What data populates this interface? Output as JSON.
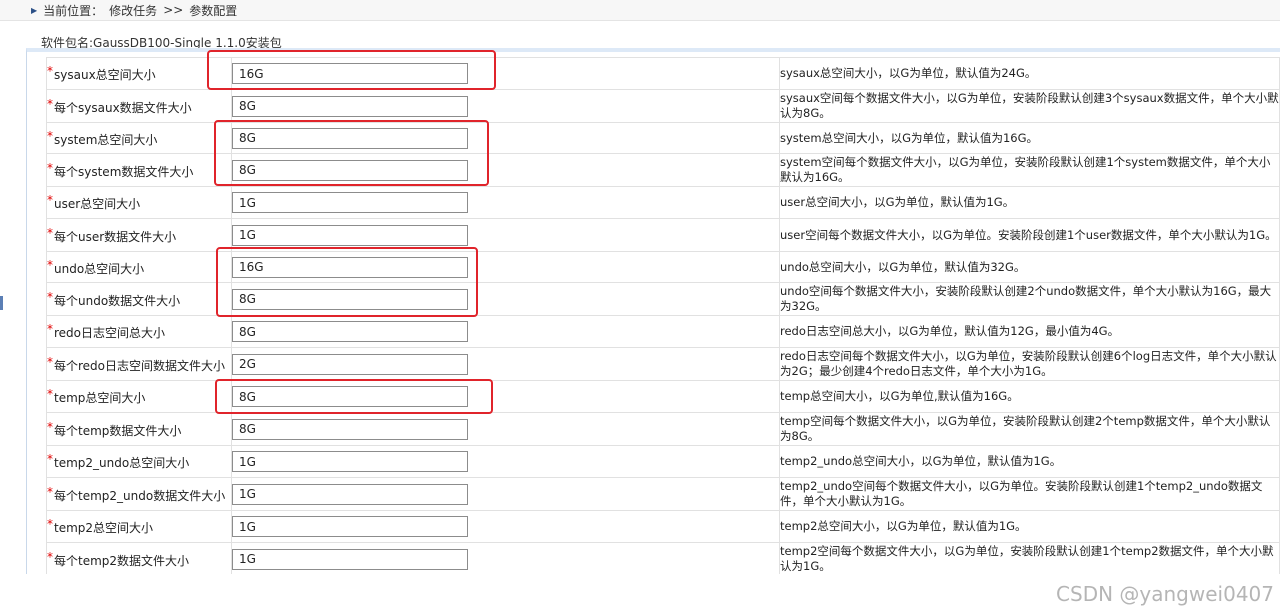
{
  "breadcrumb": {
    "prefix": "当前位置：",
    "item1": "修改任务",
    "sep": ">>",
    "item2": "参数配置"
  },
  "package_label": "软件包名:GaussDB100-Single 1.1.0安装包",
  "rows": [
    {
      "label": "sysaux总空间大小",
      "value": "16G",
      "desc": "sysaux总空间大小，以G为单位，默认值为24G。"
    },
    {
      "label": "每个sysaux数据文件大小",
      "value": "8G",
      "desc": "sysaux空间每个数据文件大小，以G为单位，安装阶段默认创建3个sysaux数据文件，单个大小默认为8G。"
    },
    {
      "label": "system总空间大小",
      "value": "8G",
      "desc": "system总空间大小，以G为单位，默认值为16G。"
    },
    {
      "label": "每个system数据文件大小",
      "value": "8G",
      "desc": "system空间每个数据文件大小，以G为单位，安装阶段默认创建1个system数据文件，单个大小默认为16G。"
    },
    {
      "label": "user总空间大小",
      "value": "1G",
      "desc": "user总空间大小，以G为单位，默认值为1G。"
    },
    {
      "label": "每个user数据文件大小",
      "value": "1G",
      "desc": "user空间每个数据文件大小，以G为单位。安装阶段创建1个user数据文件，单个大小默认为1G。"
    },
    {
      "label": "undo总空间大小",
      "value": "16G",
      "desc": "undo总空间大小，以G为单位，默认值为32G。"
    },
    {
      "label": "每个undo数据文件大小",
      "value": "8G",
      "desc": "undo空间每个数据文件大小，安装阶段默认创建2个undo数据文件，单个大小默认为16G，最大为32G。"
    },
    {
      "label": "redo日志空间总大小",
      "value": "8G",
      "desc": "redo日志空间总大小，以G为单位，默认值为12G，最小值为4G。"
    },
    {
      "label": "每个redo日志空间数据文件大小",
      "value": "2G",
      "desc": "redo日志空间每个数据文件大小，以G为单位，安装阶段默认创建6个log日志文件，单个大小默认为2G；最少创建4个redo日志文件，单个大小为1G。"
    },
    {
      "label": "temp总空间大小",
      "value": "8G",
      "desc": "temp总空间大小，以G为单位,默认值为16G。"
    },
    {
      "label": "每个temp数据文件大小",
      "value": "8G",
      "desc": "temp空间每个数据文件大小，以G为单位，安装阶段默认创建2个temp数据文件，单个大小默认为8G。"
    },
    {
      "label": "temp2_undo总空间大小",
      "value": "1G",
      "desc": "temp2_undo总空间大小，以G为单位，默认值为1G。"
    },
    {
      "label": "每个temp2_undo数据文件大小",
      "value": "1G",
      "desc": "temp2_undo空间每个数据文件大小，以G为单位。安装阶段默认创建1个temp2_undo数据文件，单个大小默认为1G。"
    },
    {
      "label": "temp2总空间大小",
      "value": "1G",
      "desc": "temp2总空间大小，以G为单位，默认值为1G。"
    },
    {
      "label": "每个temp2数据文件大小",
      "value": "1G",
      "desc": "temp2空间每个数据文件大小，以G为单位，安装阶段默认创建1个temp2数据文件，单个大小默认为1G。"
    }
  ],
  "watermark": "CSDN @yangwei0407",
  "colors": {
    "highlight": "#e0242b",
    "required_star": "#e00000"
  }
}
